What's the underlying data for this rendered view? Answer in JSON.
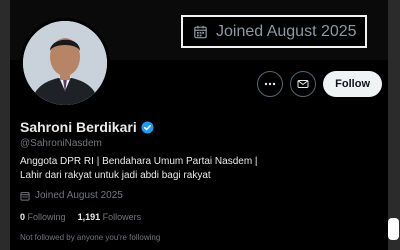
{
  "highlight": {
    "joined_text": "Joined August 2025"
  },
  "actions": {
    "more_icon": "ellipsis-icon",
    "message_icon": "envelope-icon",
    "follow_label": "Follow"
  },
  "profile": {
    "name": "Sahroni Berdikari",
    "handle": "@SahroniNasdem",
    "bio_line1": "Anggota DPR RI | Bendahara Umum Partai Nasdem |",
    "bio_line2": "Lahir dari rakyat untuk jadi abdi bagi rakyat",
    "joined_text": "Joined August 2025",
    "following_count": "0",
    "following_label": "Following",
    "followers_count": "1,191",
    "followers_label": "Followers",
    "followed_by_note": "Not followed by anyone you're following"
  },
  "colors": {
    "verified": "#1d9bf0",
    "background": "#000000",
    "muted_text": "#71767b",
    "follow_button": "#eff3f4"
  }
}
